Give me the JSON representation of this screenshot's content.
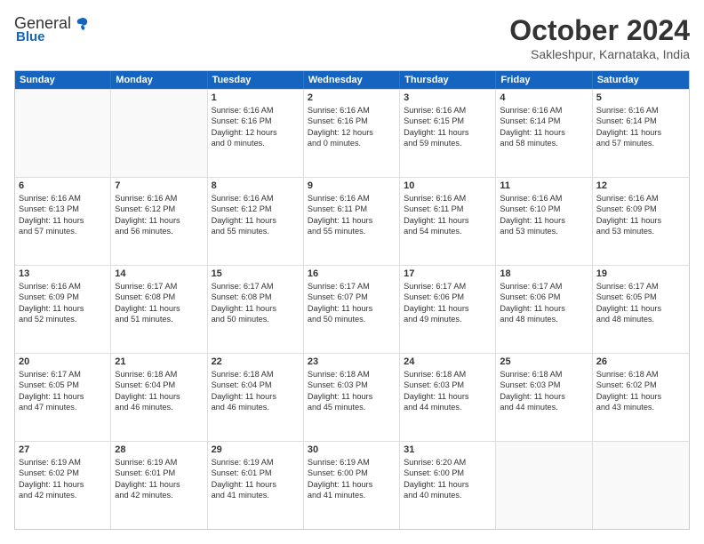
{
  "logo": {
    "general": "General",
    "blue": "Blue"
  },
  "title": "October 2024",
  "location": "Sakleshpur, Karnataka, India",
  "header_days": [
    "Sunday",
    "Monday",
    "Tuesday",
    "Wednesday",
    "Thursday",
    "Friday",
    "Saturday"
  ],
  "weeks": [
    [
      {
        "day": "",
        "text": "",
        "empty": true
      },
      {
        "day": "",
        "text": "",
        "empty": true
      },
      {
        "day": "1",
        "text": "Sunrise: 6:16 AM\nSunset: 6:16 PM\nDaylight: 12 hours\nand 0 minutes."
      },
      {
        "day": "2",
        "text": "Sunrise: 6:16 AM\nSunset: 6:16 PM\nDaylight: 12 hours\nand 0 minutes."
      },
      {
        "day": "3",
        "text": "Sunrise: 6:16 AM\nSunset: 6:15 PM\nDaylight: 11 hours\nand 59 minutes."
      },
      {
        "day": "4",
        "text": "Sunrise: 6:16 AM\nSunset: 6:14 PM\nDaylight: 11 hours\nand 58 minutes."
      },
      {
        "day": "5",
        "text": "Sunrise: 6:16 AM\nSunset: 6:14 PM\nDaylight: 11 hours\nand 57 minutes."
      }
    ],
    [
      {
        "day": "6",
        "text": "Sunrise: 6:16 AM\nSunset: 6:13 PM\nDaylight: 11 hours\nand 57 minutes."
      },
      {
        "day": "7",
        "text": "Sunrise: 6:16 AM\nSunset: 6:12 PM\nDaylight: 11 hours\nand 56 minutes."
      },
      {
        "day": "8",
        "text": "Sunrise: 6:16 AM\nSunset: 6:12 PM\nDaylight: 11 hours\nand 55 minutes."
      },
      {
        "day": "9",
        "text": "Sunrise: 6:16 AM\nSunset: 6:11 PM\nDaylight: 11 hours\nand 55 minutes."
      },
      {
        "day": "10",
        "text": "Sunrise: 6:16 AM\nSunset: 6:11 PM\nDaylight: 11 hours\nand 54 minutes."
      },
      {
        "day": "11",
        "text": "Sunrise: 6:16 AM\nSunset: 6:10 PM\nDaylight: 11 hours\nand 53 minutes."
      },
      {
        "day": "12",
        "text": "Sunrise: 6:16 AM\nSunset: 6:09 PM\nDaylight: 11 hours\nand 53 minutes."
      }
    ],
    [
      {
        "day": "13",
        "text": "Sunrise: 6:16 AM\nSunset: 6:09 PM\nDaylight: 11 hours\nand 52 minutes."
      },
      {
        "day": "14",
        "text": "Sunrise: 6:17 AM\nSunset: 6:08 PM\nDaylight: 11 hours\nand 51 minutes."
      },
      {
        "day": "15",
        "text": "Sunrise: 6:17 AM\nSunset: 6:08 PM\nDaylight: 11 hours\nand 50 minutes."
      },
      {
        "day": "16",
        "text": "Sunrise: 6:17 AM\nSunset: 6:07 PM\nDaylight: 11 hours\nand 50 minutes."
      },
      {
        "day": "17",
        "text": "Sunrise: 6:17 AM\nSunset: 6:06 PM\nDaylight: 11 hours\nand 49 minutes."
      },
      {
        "day": "18",
        "text": "Sunrise: 6:17 AM\nSunset: 6:06 PM\nDaylight: 11 hours\nand 48 minutes."
      },
      {
        "day": "19",
        "text": "Sunrise: 6:17 AM\nSunset: 6:05 PM\nDaylight: 11 hours\nand 48 minutes."
      }
    ],
    [
      {
        "day": "20",
        "text": "Sunrise: 6:17 AM\nSunset: 6:05 PM\nDaylight: 11 hours\nand 47 minutes."
      },
      {
        "day": "21",
        "text": "Sunrise: 6:18 AM\nSunset: 6:04 PM\nDaylight: 11 hours\nand 46 minutes."
      },
      {
        "day": "22",
        "text": "Sunrise: 6:18 AM\nSunset: 6:04 PM\nDaylight: 11 hours\nand 46 minutes."
      },
      {
        "day": "23",
        "text": "Sunrise: 6:18 AM\nSunset: 6:03 PM\nDaylight: 11 hours\nand 45 minutes."
      },
      {
        "day": "24",
        "text": "Sunrise: 6:18 AM\nSunset: 6:03 PM\nDaylight: 11 hours\nand 44 minutes."
      },
      {
        "day": "25",
        "text": "Sunrise: 6:18 AM\nSunset: 6:03 PM\nDaylight: 11 hours\nand 44 minutes."
      },
      {
        "day": "26",
        "text": "Sunrise: 6:18 AM\nSunset: 6:02 PM\nDaylight: 11 hours\nand 43 minutes."
      }
    ],
    [
      {
        "day": "27",
        "text": "Sunrise: 6:19 AM\nSunset: 6:02 PM\nDaylight: 11 hours\nand 42 minutes."
      },
      {
        "day": "28",
        "text": "Sunrise: 6:19 AM\nSunset: 6:01 PM\nDaylight: 11 hours\nand 42 minutes."
      },
      {
        "day": "29",
        "text": "Sunrise: 6:19 AM\nSunset: 6:01 PM\nDaylight: 11 hours\nand 41 minutes."
      },
      {
        "day": "30",
        "text": "Sunrise: 6:19 AM\nSunset: 6:00 PM\nDaylight: 11 hours\nand 41 minutes."
      },
      {
        "day": "31",
        "text": "Sunrise: 6:20 AM\nSunset: 6:00 PM\nDaylight: 11 hours\nand 40 minutes."
      },
      {
        "day": "",
        "text": "",
        "empty": true
      },
      {
        "day": "",
        "text": "",
        "empty": true
      }
    ]
  ]
}
